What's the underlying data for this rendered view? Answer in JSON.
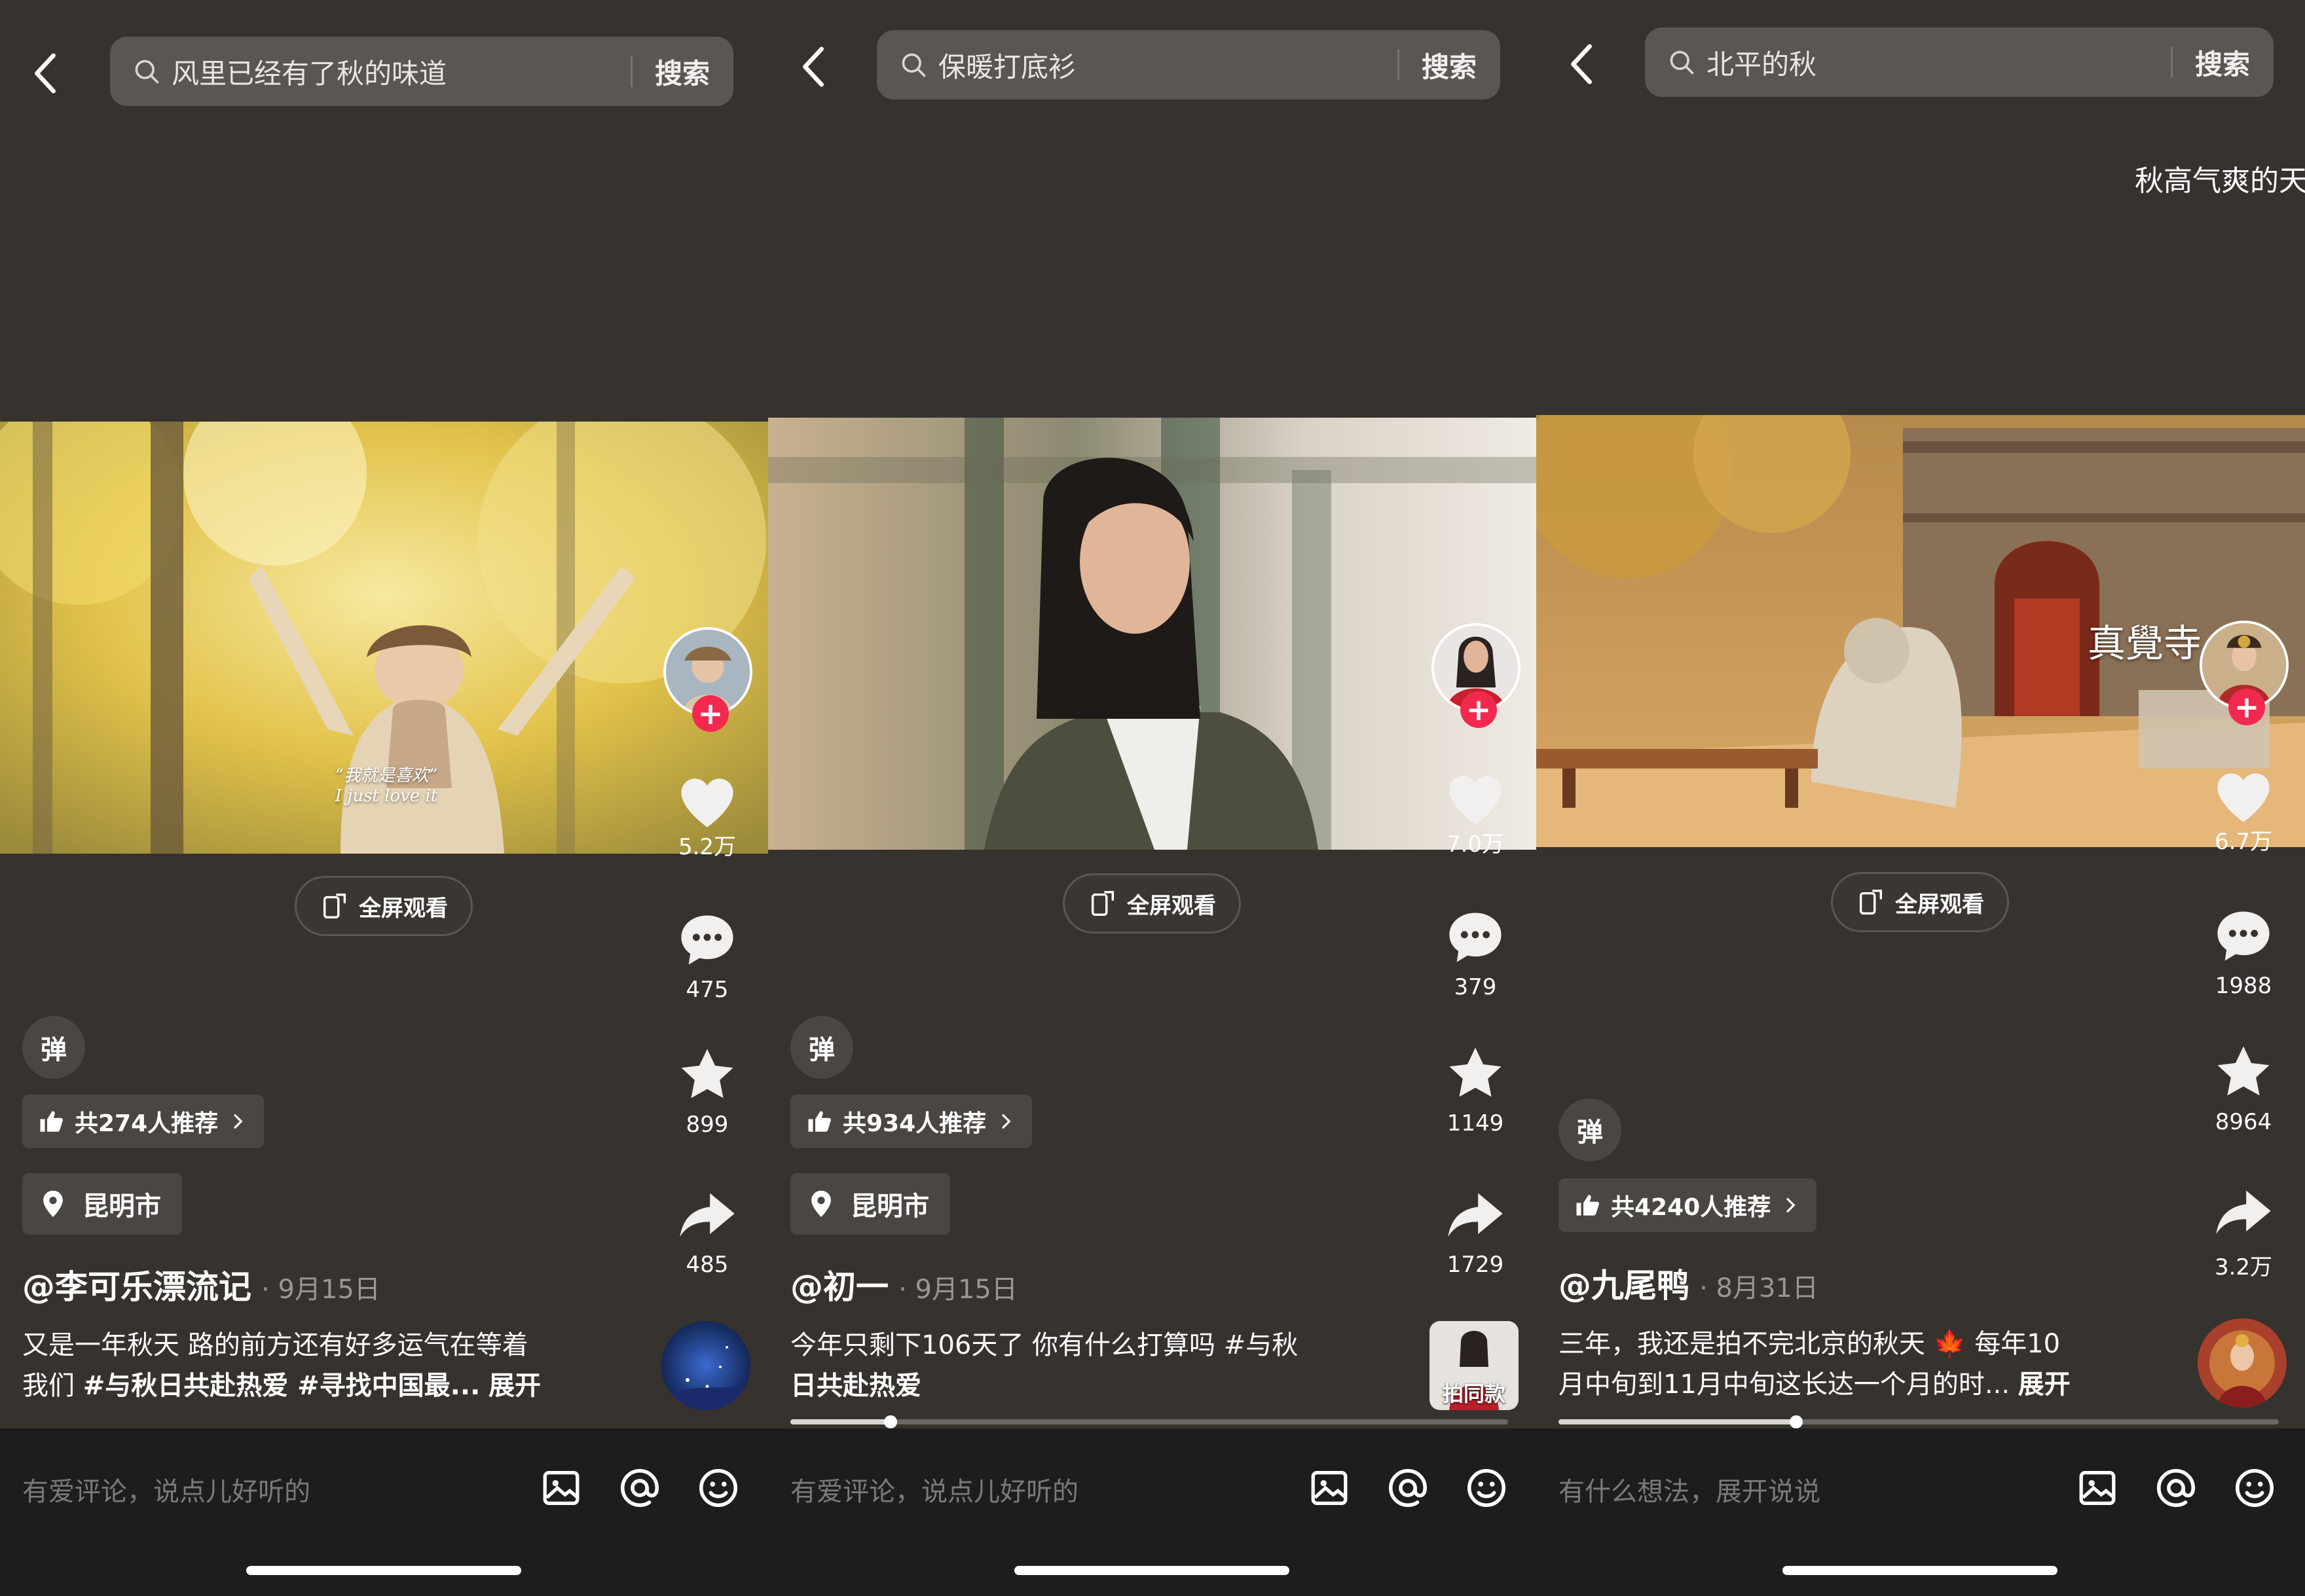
{
  "panels": [
    {
      "search_text": "风里已经有了秋的味道",
      "search_btn": "搜索",
      "float_text": "",
      "video_caption": "“我就是喜欢”\nI just love it",
      "temple_sign": "",
      "fullscreen_label": "全屏观看",
      "likes": "5.2万",
      "comments": "475",
      "favorites": "899",
      "shares": "485",
      "danmu": "弹",
      "recommend": "共274人推荐",
      "location": "昆明市",
      "author": "@李可乐漂流记",
      "date": "· 9月15日",
      "desc_line1": "又是一年秋天 路的前方还有好多运气在等着",
      "desc_line2_plain": "我们 ",
      "desc_line2_tags": "#与秋日共赴热爱 #寻找中国最...",
      "desc_more": "展开",
      "same_label": "",
      "progress": 0,
      "comment_placeholder": "有爱评论，说点儿好听的"
    },
    {
      "search_text": "保暖打底衫",
      "search_btn": "搜索",
      "float_text": "",
      "video_caption": "",
      "temple_sign": "",
      "fullscreen_label": "全屏观看",
      "likes": "7.0万",
      "comments": "379",
      "favorites": "1149",
      "shares": "1729",
      "danmu": "弹",
      "recommend": "共934人推荐",
      "location": "昆明市",
      "author": "@初一",
      "date": "· 9月15日",
      "desc_line1": "今年只剩下106天了 你有什么打算吗 #与秋",
      "desc_line2_plain": "",
      "desc_line2_tags": "日共赴热爱",
      "desc_more": "",
      "same_label": "拍同款",
      "progress": 0.14,
      "comment_placeholder": "有爱评论，说点儿好听的"
    },
    {
      "search_text": "北平的秋",
      "search_btn": "搜索",
      "float_text": "秋高气爽的天",
      "video_caption": "",
      "temple_sign": "真覺寺",
      "fullscreen_label": "全屏观看",
      "likes": "6.7万",
      "comments": "1988",
      "favorites": "8964",
      "shares": "3.2万",
      "danmu": "弹",
      "recommend": "共4240人推荐",
      "location": "",
      "author": "@九尾鸭",
      "date": "· 8月31日",
      "desc_line1": "三年，我还是拍不完北京的秋天 🍁 每年10",
      "desc_line2_plain": "月中旬到11月中旬这长达一个月的时...",
      "desc_line2_tags": "",
      "desc_more": "展开",
      "same_label": "",
      "progress": 0.33,
      "comment_placeholder": "有什么想法，展开说说"
    }
  ],
  "icons": [
    "back-chevron-icon",
    "search-icon",
    "fullscreen-icon",
    "heart-icon",
    "comment-icon",
    "star-icon",
    "share-icon",
    "thumbs-up-icon",
    "chevron-right-icon",
    "location-pin-icon",
    "image-icon",
    "at-icon",
    "emoji-icon"
  ],
  "colors": {
    "background": "#36322e",
    "search_bg": "#5a5651",
    "chip_bg": "#4a4642",
    "follow_red": "#f2294f",
    "comment_bar": "#1d1d1d"
  }
}
